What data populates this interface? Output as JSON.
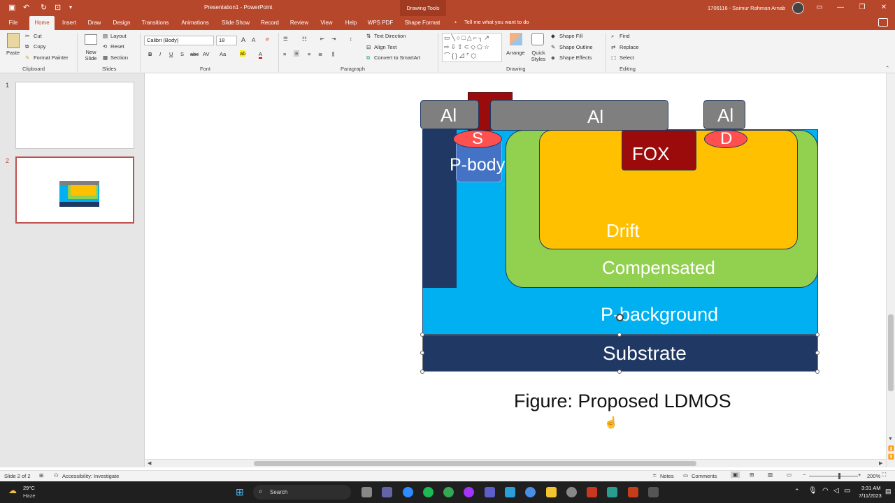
{
  "app": {
    "title": "Presentation1  -  PowerPoint",
    "context_tab": "Drawing Tools",
    "user": "1706116 - Saimur Rahman Arnab"
  },
  "tabs": [
    "File",
    "Home",
    "Insert",
    "Draw",
    "Design",
    "Transitions",
    "Animations",
    "Slide Show",
    "Record",
    "Review",
    "View",
    "Help",
    "WPS PDF",
    "Shape Format"
  ],
  "tell_me": "Tell me what you want to do",
  "ribbon": {
    "clipboard": {
      "paste": "Paste",
      "cut": "Cut",
      "copy": "Copy",
      "format_painter": "Format Painter",
      "label": "Clipboard"
    },
    "slides": {
      "new_slide": "New Slide",
      "layout": "Layout",
      "reset": "Reset",
      "section": "Section",
      "label": "Slides"
    },
    "font": {
      "font_name": "Calibri (Body)",
      "font_size": "18",
      "label": "Font"
    },
    "paragraph": {
      "text_direction": "Text Direction",
      "align_text": "Align Text",
      "convert_smartart": "Convert to SmartArt",
      "label": "Paragraph"
    },
    "drawing": {
      "arrange": "Arrange",
      "quick_styles": "Quick Styles",
      "shape_fill": "Shape Fill",
      "shape_outline": "Shape Outline",
      "shape_effects": "Shape Effects",
      "label": "Drawing"
    },
    "editing": {
      "find": "Find",
      "replace": "Replace",
      "select": "Select",
      "label": "Editing"
    }
  },
  "slides_panel": {
    "slide1_num": "1",
    "slide2_num": "2"
  },
  "diagram": {
    "al_left": "Al",
    "al_mid": "Al",
    "al_right": "Al",
    "s": "S",
    "d": "D",
    "p_body": "P-body",
    "fox": "FOX",
    "drift": "Drift",
    "compensated": "Compensated",
    "p_background": "P-background",
    "substrate": "Substrate",
    "caption": "Figure: Proposed LDMOS",
    "colors": {
      "al": "#7f7f7f",
      "gate": "#9b0b0b",
      "pbg": "#00b0f0",
      "compensated": "#92d050",
      "drift": "#ffc000",
      "substrate": "#1f3864",
      "pbody": "#4472c4",
      "contact": "#ff5050",
      "pillar": "#1f3864"
    }
  },
  "status": {
    "slide": "Slide 2 of 2",
    "accessibility": "Accessibility: Investigate",
    "notes": "Notes",
    "comments": "Comments",
    "zoom": "200%"
  },
  "taskbar": {
    "temp": "29°C",
    "weather": "Haze",
    "search": "Search",
    "time": "3:31 AM",
    "date": "7/11/2023"
  }
}
